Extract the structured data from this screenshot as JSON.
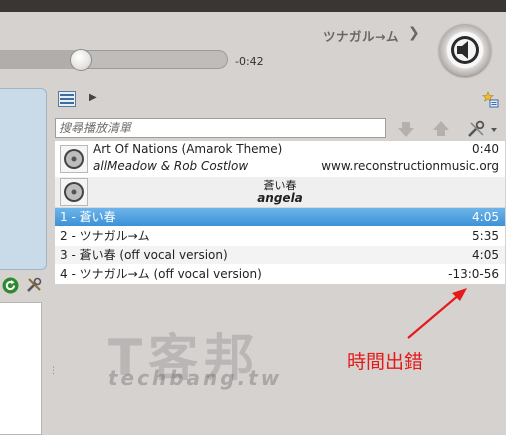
{
  "player": {
    "time_remaining": "-0:42",
    "current_track": "ツナガル→ム",
    "seek_progress": 0.36
  },
  "search": {
    "placeholder": "搜尋播放清單"
  },
  "playlist": {
    "album1": {
      "title": "Art Of Nations (Amarok Theme)",
      "artist": "allMeadow & Rob Costlow",
      "length": "0:40",
      "url": "www.reconstructionmusic.org"
    },
    "album2": {
      "title": "蒼い春",
      "artist": "angela"
    },
    "tracks": [
      {
        "title": "1 - 蒼い春",
        "length": "4:05"
      },
      {
        "title": "2 - ツナガル→ム",
        "length": "5:35"
      },
      {
        "title": "3 - 蒼い春 (off vocal version)",
        "length": "4:05"
      },
      {
        "title": "4 - ツナガル→ム (off vocal version)",
        "length": "-13:0-56"
      }
    ]
  },
  "annotation": {
    "text": "時間出錯",
    "color": "#e41b1b"
  },
  "watermark": {
    "logo": "T客邦",
    "site": "techbang.tw"
  },
  "colors": {
    "selection": "#56a6e3",
    "panel_blue": "#c9dbe8"
  }
}
